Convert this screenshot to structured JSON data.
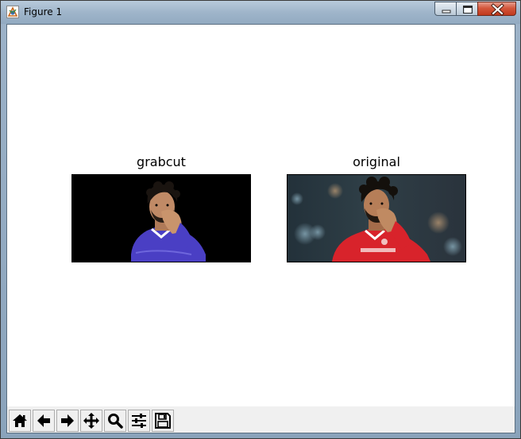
{
  "window": {
    "title": "Figure 1"
  },
  "figure": {
    "axes": [
      {
        "title": "grabcut",
        "image": "segmented-player-on-black-background"
      },
      {
        "title": "original",
        "image": "player-photo-red-kit"
      }
    ]
  },
  "toolbar": {
    "buttons": [
      {
        "name": "home",
        "icon": "home-icon"
      },
      {
        "name": "back",
        "icon": "arrow-left-icon"
      },
      {
        "name": "forward",
        "icon": "arrow-right-icon"
      },
      {
        "name": "pan",
        "icon": "move-icon"
      },
      {
        "name": "zoom",
        "icon": "magnifier-icon"
      },
      {
        "name": "configure-subplots",
        "icon": "sliders-icon"
      },
      {
        "name": "save",
        "icon": "floppy-disk-icon"
      }
    ]
  },
  "colors": {
    "titlebar": "#9fb5ca",
    "close_button": "#c0391d",
    "canvas": "#ffffff",
    "toolbar": "#f0f0f0",
    "jersey_grabcut": "#4a3fc4",
    "jersey_original": "#d8232b"
  }
}
